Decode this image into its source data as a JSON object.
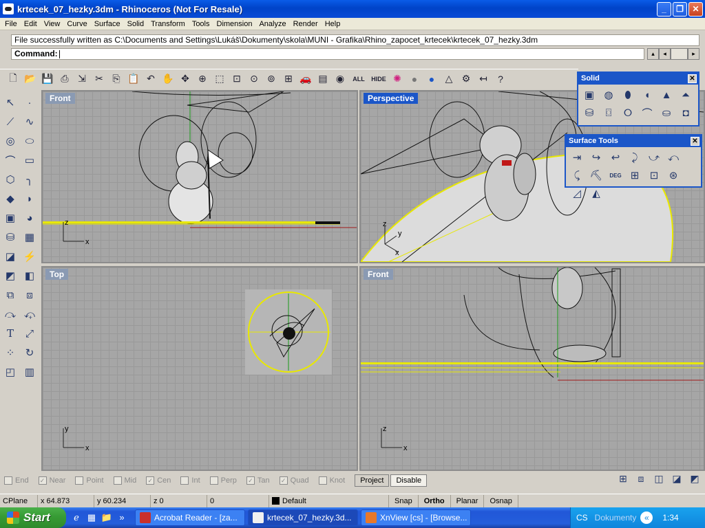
{
  "window": {
    "title": "krtecek_07_hezky.3dm - Rhinoceros (Not For Resale)",
    "min": "_",
    "max": "❐",
    "close": "✕"
  },
  "menu": [
    "File",
    "Edit",
    "View",
    "Curve",
    "Surface",
    "Solid",
    "Transform",
    "Tools",
    "Dimension",
    "Analyze",
    "Render",
    "Help"
  ],
  "command": {
    "history": "File successfully written as C:\\Documents and Settings\\Lukáš\\Dokumenty\\skola\\MUNI - Grafika\\Rhino_zapocet_krtecek\\krtecek_07_hezky.3dm",
    "prompt": "Command:",
    "value": ""
  },
  "toolbar": {
    "all_label": "ALL",
    "hide_label": "HIDE"
  },
  "viewports": {
    "front1": "Front",
    "perspective": "Perspective",
    "top": "Top",
    "front2": "Front"
  },
  "axes": {
    "x": "x",
    "y": "y",
    "z": "z"
  },
  "panels": {
    "solid": {
      "title": "Solid"
    },
    "surface_tools": {
      "title": "Surface Tools",
      "deg_label": "DEG"
    }
  },
  "osnap": {
    "items": [
      {
        "label": "End",
        "checked": false
      },
      {
        "label": "Near",
        "checked": true
      },
      {
        "label": "Point",
        "checked": false
      },
      {
        "label": "Mid",
        "checked": false
      },
      {
        "label": "Cen",
        "checked": true
      },
      {
        "label": "Int",
        "checked": false
      },
      {
        "label": "Perp",
        "checked": false
      },
      {
        "label": "Tan",
        "checked": true
      },
      {
        "label": "Quad",
        "checked": true
      },
      {
        "label": "Knot",
        "checked": false
      }
    ],
    "project": "Project",
    "disable": "Disable"
  },
  "status": {
    "cplane": "CPlane",
    "x": "x 64.873",
    "y": "y 60.234",
    "z": "z 0",
    "value": "0",
    "layer": "Default",
    "snap": "Snap",
    "ortho": "Ortho",
    "planar": "Planar",
    "osnap": "Osnap"
  },
  "taskbar": {
    "start": "Start",
    "tasks": [
      {
        "label": "Acrobat Reader - [za...",
        "color": "#c8302c"
      },
      {
        "label": "krtecek_07_hezky.3d...",
        "color": "#f0f0f0"
      },
      {
        "label": "XnView [cs] - [Browse...",
        "color": "#e8782a"
      }
    ],
    "lang": "CS",
    "folder": "Dokumenty",
    "clock": "1:34"
  }
}
